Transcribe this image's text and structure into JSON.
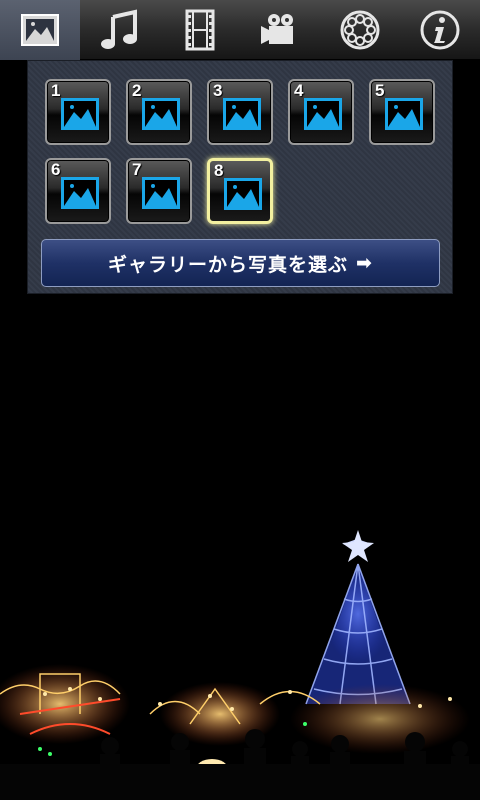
{
  "tabs": [
    {
      "id": "photo",
      "icon": "picture-icon",
      "active": true
    },
    {
      "id": "music",
      "icon": "music-note-icon",
      "active": false
    },
    {
      "id": "film",
      "icon": "film-strip-icon",
      "active": false
    },
    {
      "id": "movie",
      "icon": "movie-camera-icon",
      "active": false
    },
    {
      "id": "reel",
      "icon": "film-reel-icon",
      "active": false
    },
    {
      "id": "info",
      "icon": "info-icon",
      "active": false
    }
  ],
  "slots": [
    {
      "number": "1",
      "selected": false
    },
    {
      "number": "2",
      "selected": false
    },
    {
      "number": "3",
      "selected": false
    },
    {
      "number": "4",
      "selected": false
    },
    {
      "number": "5",
      "selected": false
    },
    {
      "number": "6",
      "selected": false
    },
    {
      "number": "7",
      "selected": false
    },
    {
      "number": "8",
      "selected": true
    }
  ],
  "gallery_button": {
    "label": "ギャラリーから写真を選ぶ",
    "arrow": "➡"
  },
  "colors": {
    "accent_blue": "#1aa6e8",
    "selected_border": "#f3f0a0",
    "button_blue": "#1f3166"
  }
}
